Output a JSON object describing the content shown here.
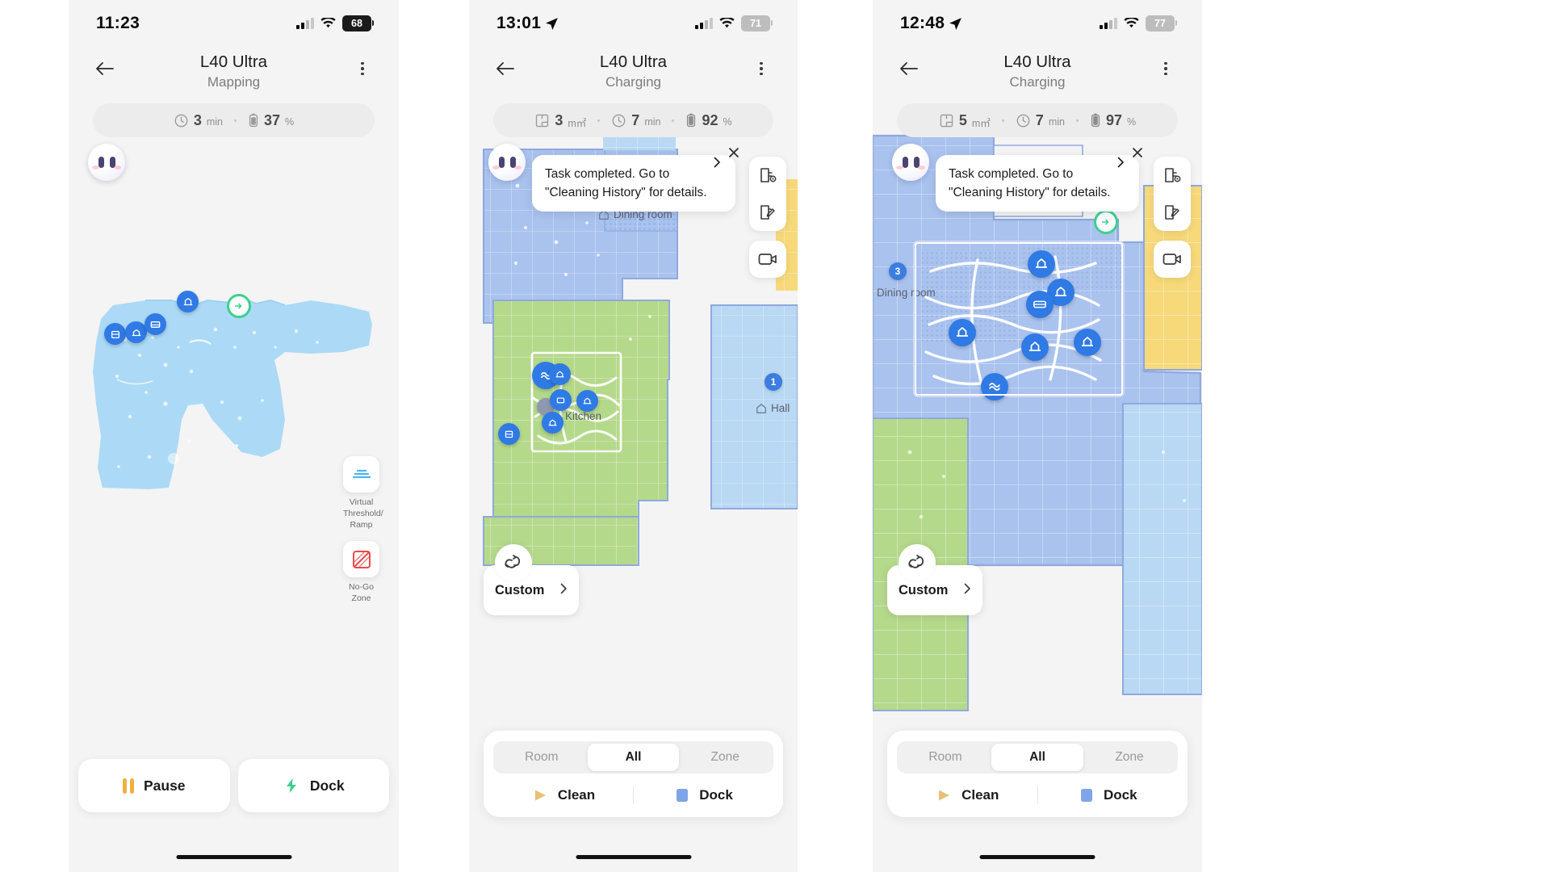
{
  "panels": [
    {
      "id": "mapping",
      "status": {
        "time": "11:23",
        "location_arrow": false,
        "signal": "signal-bars",
        "wifi": "wifi-icon",
        "battery": "68",
        "battery_dim": false
      },
      "nav": {
        "back": "back-arrow",
        "title": "L40 Ultra",
        "subtitle": "Mapping",
        "menu": "kebab-menu"
      },
      "chips": [
        {
          "icon": "clock-icon",
          "value": "3",
          "unit": "min"
        },
        {
          "icon": "battery-icon",
          "value": "37",
          "unit": "%"
        }
      ],
      "map_tools": [
        {
          "icon": "virtual-threshold-icon",
          "caption": "Virtual Threshold/ Ramp"
        },
        {
          "icon": "no-go-zone-icon",
          "caption": "No-Go Zone"
        }
      ],
      "buttons": [
        {
          "icon": "pause-icon",
          "label": "Pause"
        },
        {
          "icon": "dock-bolt-icon",
          "label": "Dock"
        }
      ]
    },
    {
      "id": "charging-1",
      "status": {
        "time": "13:01",
        "location_arrow": true,
        "signal": "signal-bars",
        "wifi": "wifi-icon",
        "battery": "71",
        "battery_dim": true
      },
      "nav": {
        "back": "back-arrow",
        "title": "L40 Ultra",
        "subtitle": "Charging",
        "menu": "kebab-menu"
      },
      "chips": [
        {
          "icon": "area-icon",
          "value": "3",
          "unit": "m㎡"
        },
        {
          "icon": "clock-icon",
          "value": "7",
          "unit": "min"
        },
        {
          "icon": "battery-icon",
          "value": "92",
          "unit": "%"
        }
      ],
      "toast": {
        "text": "Task completed. Go to \"Cleaning History\" for details.",
        "chevron": "chevron-right-icon",
        "close": "close-icon"
      },
      "rail": [
        {
          "icon": "map-view-icon"
        },
        {
          "icon": "map-edit-icon"
        },
        {
          "icon": "video-icon"
        }
      ],
      "fan_card": {
        "icon": "fan-icon",
        "label": "Custom",
        "chevron": "chevron-right-icon"
      },
      "segments": [
        "Room",
        "All",
        "Zone"
      ],
      "segment_active": "All",
      "actions": [
        {
          "icon": "play-icon",
          "label": "Clean"
        },
        {
          "icon": "dock-square-icon",
          "label": "Dock"
        }
      ],
      "rooms": [
        {
          "name": "Dining room",
          "icon": "home-icon"
        },
        {
          "name": "Kitchen",
          "icon": "home-icon"
        },
        {
          "name": "Hall",
          "icon": "home-icon",
          "badge": "1"
        }
      ]
    },
    {
      "id": "charging-2",
      "status": {
        "time": "12:48",
        "location_arrow": true,
        "signal": "signal-bars",
        "wifi": "wifi-icon",
        "battery": "77",
        "battery_dim": true
      },
      "nav": {
        "back": "back-arrow",
        "title": "L40 Ultra",
        "subtitle": "Charging",
        "menu": "kebab-menu"
      },
      "chips": [
        {
          "icon": "area-icon",
          "value": "5",
          "unit": "m㎡"
        },
        {
          "icon": "clock-icon",
          "value": "7",
          "unit": "min"
        },
        {
          "icon": "battery-icon",
          "value": "97",
          "unit": "%"
        }
      ],
      "toast": {
        "text": "Task completed. Go to \"Cleaning History\" for details.",
        "chevron": "chevron-right-icon",
        "close": "close-icon"
      },
      "rail": [
        {
          "icon": "map-view-icon"
        },
        {
          "icon": "map-edit-icon"
        },
        {
          "icon": "video-icon"
        }
      ],
      "fan_card": {
        "icon": "fan-icon",
        "label": "Custom",
        "chevron": "chevron-right-icon"
      },
      "segments": [
        "Room",
        "All",
        "Zone"
      ],
      "segment_active": "All",
      "actions": [
        {
          "icon": "play-icon",
          "label": "Clean"
        },
        {
          "icon": "dock-square-icon",
          "label": "Dock"
        }
      ],
      "rooms": [
        {
          "name": "Dining room",
          "icon": "home-icon",
          "badge": "3"
        }
      ]
    }
  ],
  "colors": {
    "room_blue": "#a9c2ee",
    "room_blue_light": "#b9d8f3",
    "room_green": "#b5d98b",
    "room_yellow": "#f7d97a",
    "map_mapping": "#a8d8f5",
    "accent_green": "#3ecf8e",
    "accent_amber": "#f0b040",
    "accent_blue": "#2f7ae5",
    "bg": "#f4f4f4"
  }
}
